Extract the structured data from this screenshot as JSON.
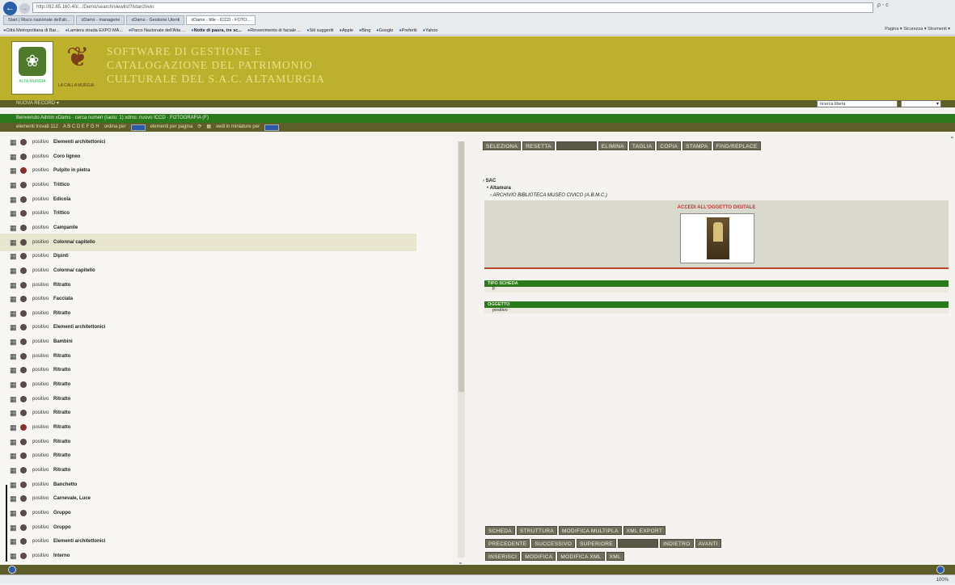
{
  "browser": {
    "address": "http://82.85.160.40/.../Demo/search/viewlist?/idarchivio",
    "search_label": "ρ - c",
    "tabs": [
      {
        "label": "Start | Risco nazionale dell'alt...",
        "active": false
      },
      {
        "label": "xDams - managerie",
        "active": false
      },
      {
        "label": "xDams - Gestione Utenti",
        "active": false
      },
      {
        "label": "xDams - title - ICCD - FOTO...",
        "active": true
      }
    ],
    "favorites": [
      {
        "label": "Città Metropolitana di Bar...",
        "bold": false
      },
      {
        "label": "Lamiera strada EXPO MA...",
        "bold": false
      },
      {
        "label": "Parco Nazionale dell'Alta ...",
        "bold": false
      },
      {
        "label": "Notte di paura, tre sc...",
        "bold": true
      },
      {
        "label": "Rinvenimento di faciale ...",
        "bold": false
      },
      {
        "label": "Siti suggeriti",
        "bold": false
      },
      {
        "label": "Apple",
        "bold": false
      },
      {
        "label": "Bing",
        "bold": false
      },
      {
        "label": "Google",
        "bold": false
      },
      {
        "label": "Preferiti",
        "bold": false
      },
      {
        "label": "Yahoo",
        "bold": false
      }
    ],
    "ie_tools": "Pagina ▾  Sicurezza ▾  Strumenti ▾",
    "zoom": "100%"
  },
  "header": {
    "logo1_text": "ALTA MURGIA",
    "logo2_text": "LA CALLA MURGIA",
    "title_lines": [
      "SOFTWARE DI GESTIONE E",
      "CATALOGAZIONE DEL PATRIMONIO",
      "CULTURALE DEL S.A.C. ALTAMURGIA"
    ]
  },
  "menubar": {
    "new_record": "NUOVA RECORD ▾",
    "quick_search_placeholder": "ricerca libera",
    "quick_select": "▾"
  },
  "userbar": {
    "text": "Benvenuto Admin xDams · cerca numeri (Iaolo: 1)    xdms: nuovo ICCD · FOTOGRAFIA (F)"
  },
  "toolbar2": {
    "count_label": "elementi trovati 112",
    "letters": "A B C D E F G H",
    "order_label": "ordina per",
    "per_page_label": "elementi per pagina",
    "mode_label": "vedi in miniature per"
  },
  "list": {
    "rows": [
      {
        "tipo": "positivo",
        "oggetto": "Elementi architettonici",
        "dot": "dark"
      },
      {
        "tipo": "positivo",
        "oggetto": "Coro ligneo",
        "dot": "dark"
      },
      {
        "tipo": "positivo",
        "oggetto": "Pulpito in pietra",
        "dot": "red"
      },
      {
        "tipo": "positivo",
        "oggetto": "Trittico",
        "dot": "dark"
      },
      {
        "tipo": "positivo",
        "oggetto": "Edicola",
        "dot": "dark"
      },
      {
        "tipo": "positivo",
        "oggetto": "Trittico",
        "dot": "dark"
      },
      {
        "tipo": "positivo",
        "oggetto": "Campanile",
        "dot": "dark"
      },
      {
        "tipo": "positivo",
        "oggetto": "Colonna/ capitello",
        "dot": "dark",
        "highlight": true
      },
      {
        "tipo": "positivo",
        "oggetto": "Dipinti",
        "dot": "dark"
      },
      {
        "tipo": "positivo",
        "oggetto": "Colonna/ capitello",
        "dot": "dark"
      },
      {
        "tipo": "positivo",
        "oggetto": "Ritratto",
        "dot": "dark"
      },
      {
        "tipo": "positivo",
        "oggetto": "Facciata",
        "dot": "dark"
      },
      {
        "tipo": "positivo",
        "oggetto": "Ritratto",
        "dot": "dark"
      },
      {
        "tipo": "positivo",
        "oggetto": "Elementi architettonici",
        "dot": "dark"
      },
      {
        "tipo": "positivo",
        "oggetto": "Bambini",
        "dot": "dark"
      },
      {
        "tipo": "positivo",
        "oggetto": "Ritratto",
        "dot": "dark"
      },
      {
        "tipo": "positivo",
        "oggetto": "Ritratto",
        "dot": "dark"
      },
      {
        "tipo": "positivo",
        "oggetto": "Ritratto",
        "dot": "dark"
      },
      {
        "tipo": "positivo",
        "oggetto": "Ritratto",
        "dot": "dark"
      },
      {
        "tipo": "positivo",
        "oggetto": "Ritratto",
        "dot": "dark"
      },
      {
        "tipo": "positivo",
        "oggetto": "Ritratto",
        "dot": "red"
      },
      {
        "tipo": "positivo",
        "oggetto": "Ritratto",
        "dot": "dark"
      },
      {
        "tipo": "positivo",
        "oggetto": "Ritratto",
        "dot": "dark"
      },
      {
        "tipo": "positivo",
        "oggetto": "Ritratto",
        "dot": "dark"
      },
      {
        "tipo": "positivo",
        "oggetto": "Banchetto",
        "dot": "dark"
      },
      {
        "tipo": "positivo",
        "oggetto": "Carnevale, Luce",
        "dot": "dark"
      },
      {
        "tipo": "positivo",
        "oggetto": "Gruppo",
        "dot": "dark"
      },
      {
        "tipo": "positivo",
        "oggetto": "Gruppo",
        "dot": "dark"
      },
      {
        "tipo": "positivo",
        "oggetto": "Elementi architettonici",
        "dot": "dark"
      },
      {
        "tipo": "positivo",
        "oggetto": "Interno",
        "dot": "dark"
      }
    ]
  },
  "detail": {
    "top_buttons": [
      "SELEZIONA",
      "RESETTA",
      "",
      "ELIMINA",
      "TAGLIA",
      "COPIA",
      "STAMPA",
      "FIND/REPLACE"
    ],
    "tree": [
      "SAC",
      "Altamura",
      "ARCHIVIO BIBLIOTECA MUSEO CIVICO (A.B.M.C.)"
    ],
    "image_title": "ACCEDI ALL'OGGETTO DIGITALE",
    "sections": [
      {
        "head": "TIPO SCHEDA",
        "value": "F"
      },
      {
        "head": "OGGETTO",
        "value": "positivo"
      }
    ],
    "bottom_row1": [
      "SCHEDA",
      "STRUTTURA",
      "MODIFICA MULTIPLA",
      "XML EXPORT"
    ],
    "bottom_row2": [
      "PRECEDENTE",
      "SUCCESSIVO",
      "SUPERIORE",
      "",
      "INDIETRO",
      "AVANTI"
    ],
    "bottom_row3": [
      "INSERISCI",
      "MODIFICA",
      "MODIFICA XML",
      "XML"
    ]
  },
  "colors": {
    "header": "#bcb02c",
    "menubar": "#5d5e2a",
    "userbar": "#2a7a1c",
    "button": "#6f6e5b",
    "accent_red": "#c9332e"
  }
}
